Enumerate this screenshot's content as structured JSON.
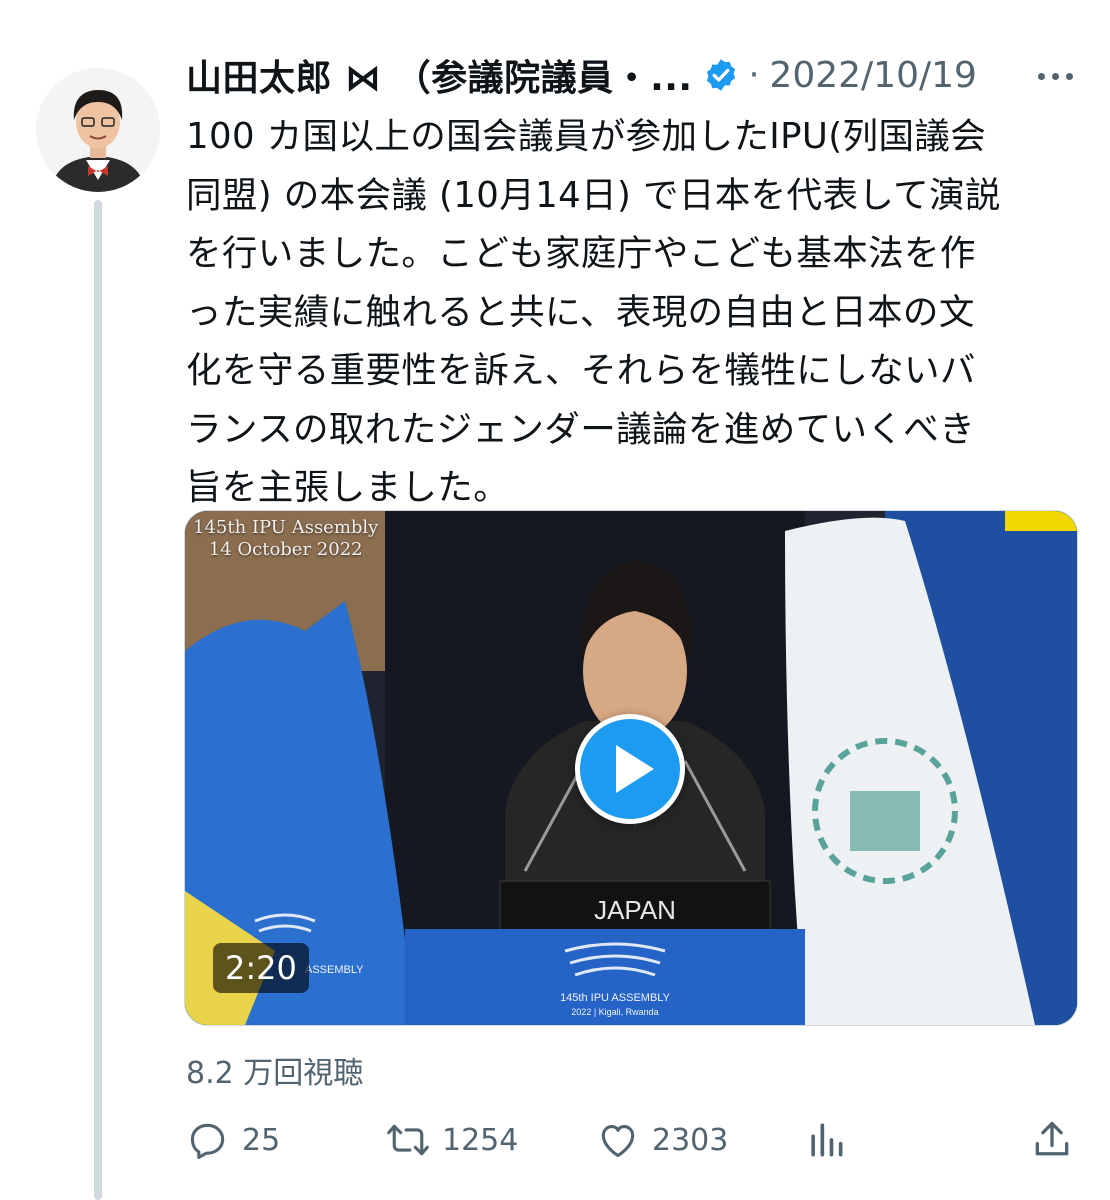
{
  "user": {
    "display_name": "山田太郎 ⋈ （参議院議員・...",
    "separator": "·",
    "date": "2022/10/19"
  },
  "tweet": {
    "lines": [
      "100 カ国以上の国会議員が参加したIPU(列国議会",
      "同盟) の本会議 (10月14日) で日本を代表して演説",
      "を行いました。こども家庭庁やこども基本法を作",
      "った実績に触れると共に、表現の自由と日本の文",
      "化を守る重要性を訴え、それらを犠牲にしないバ",
      "ランスの取れたジェンダー議論を進めていくべき",
      "旨を主張しました。"
    ]
  },
  "media": {
    "overlay_title_line1": "145th IPU Assembly",
    "overlay_title_line2": "14 October 2022",
    "nameplate": "JAPAN",
    "podium_line1": "145th IPU ASSEMBLY",
    "podium_line2": "2022 | Kigali, Rwanda",
    "banner_text": "ASSEMBLY",
    "duration": "2:20"
  },
  "views": "8.2 万回視聴",
  "actions": {
    "replies": "25",
    "retweets": "1254",
    "likes": "2303"
  },
  "colors": {
    "accent": "#1d9bf0",
    "secondary_text": "#536471",
    "thread_line": "#cfd9de"
  },
  "icons": [
    "verified-badge-icon",
    "more-icon",
    "reply-icon",
    "retweet-icon",
    "like-icon",
    "analytics-icon",
    "share-icon",
    "play-icon"
  ]
}
